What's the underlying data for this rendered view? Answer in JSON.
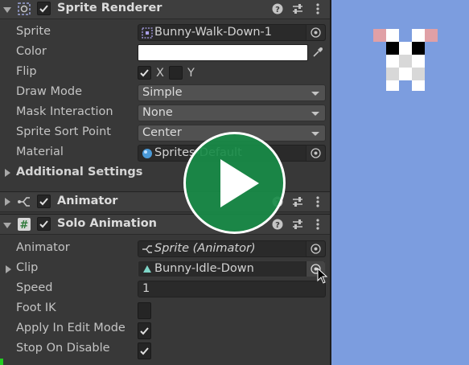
{
  "sprite_renderer": {
    "title": "Sprite Renderer",
    "sprite_label": "Sprite",
    "sprite_value": "Bunny-Walk-Down-1",
    "color_label": "Color",
    "color_value": "#ffffff",
    "flip_label": "Flip",
    "flip_x_label": "X",
    "flip_y_label": "Y",
    "flip_x": true,
    "flip_y": false,
    "draw_mode_label": "Draw Mode",
    "draw_mode_value": "Simple",
    "mask_label": "Mask Interaction",
    "mask_value": "None",
    "sort_point_label": "Sprite Sort Point",
    "sort_point_value": "Center",
    "material_label": "Material",
    "material_value": "Sprites-Default",
    "additional_settings_label": "Additional Settings"
  },
  "animator": {
    "title": "Animator"
  },
  "solo_animation": {
    "title": "Solo Animation",
    "animator_label": "Animator",
    "animator_value": "Sprite (Animator)",
    "clip_label": "Clip",
    "clip_value": "Bunny-Idle-Down",
    "speed_label": "Speed",
    "speed_value": "1",
    "foot_ik_label": "Foot IK",
    "foot_ik": false,
    "apply_edit_label": "Apply In Edit Mode",
    "apply_edit": true,
    "stop_disable_label": "Stop On Disable",
    "stop_disable": true
  },
  "colors": {
    "inspector_bg": "#383838",
    "scene_bg": "#7c9ddf",
    "play_overlay": "#188c48"
  }
}
